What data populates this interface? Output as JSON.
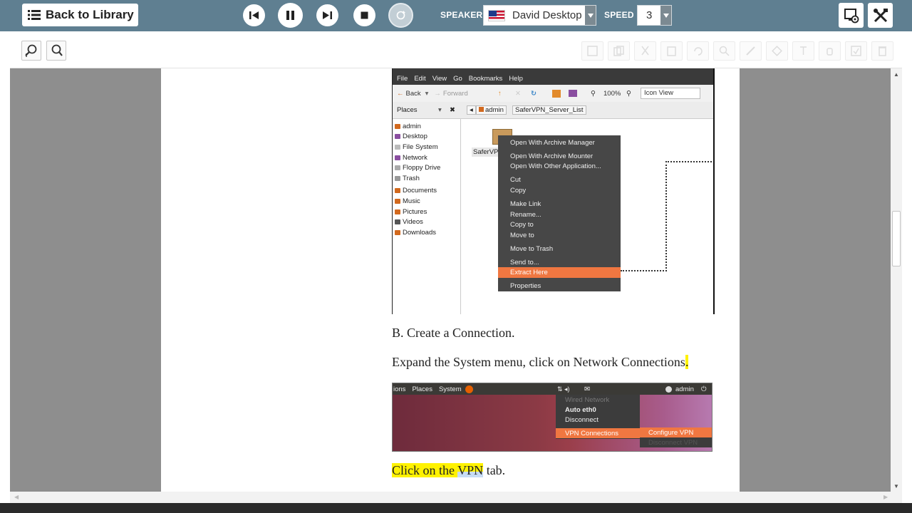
{
  "toolbar": {
    "back_label": "Back to Library",
    "speaker_label": "SPEAKER",
    "speaker_value": "David Desktop",
    "speed_label": "SPEED",
    "speed_value": "3"
  },
  "file_manager": {
    "menubar": [
      "File",
      "Edit",
      "View",
      "Go",
      "Bookmarks",
      "Help"
    ],
    "nav": {
      "back": "Back",
      "forward": "Forward",
      "zoom": "100%",
      "view": "Icon View"
    },
    "places_label": "Places",
    "breadcrumb": [
      "admin",
      "SaferVPN_Server_List"
    ],
    "sidebar": [
      "admin",
      "Desktop",
      "File System",
      "Network",
      "Floppy Drive",
      "Trash",
      "Documents",
      "Music",
      "Pictures",
      "Videos",
      "Downloads"
    ],
    "file_label": "SaferVPN",
    "context_menu": [
      "Open With Archive Manager",
      "Open With Archive Mounter",
      "Open With Other Application...",
      "Cut",
      "Copy",
      "Make Link",
      "Rename...",
      "Copy to",
      "Move to",
      "Move to Trash",
      "Send to...",
      "Extract Here",
      "Properties"
    ]
  },
  "doc": {
    "step_b": "B. Create a Connection.",
    "expand_text": "Expand the System menu, click on Network Connections",
    "expand_end": ".",
    "vpn_pre": "Click on the ",
    "vpn_word": "VPN",
    "vpn_post": " tab."
  },
  "panel_shot": {
    "menus": [
      "ions",
      "Places",
      "System"
    ],
    "user": "admin",
    "menu_items": [
      "Wired Network",
      "Auto eth0",
      "Disconnect",
      "VPN Connections"
    ],
    "submenu": [
      "Configure VPN",
      "Disconnect VPN"
    ]
  }
}
